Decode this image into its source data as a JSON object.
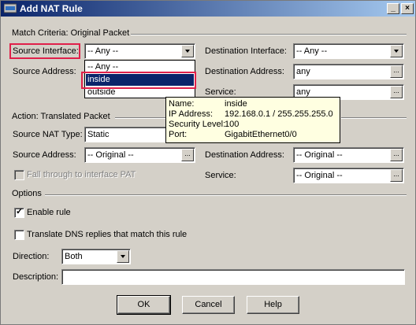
{
  "window": {
    "title": "Add NAT Rule",
    "minimize": "_",
    "close": "×"
  },
  "match": {
    "section_title": "Match Criteria: Original Packet",
    "source_interface_label": "Source Interface:",
    "source_interface_value": "-- Any --",
    "destination_interface_label": "Destination Interface:",
    "destination_interface_value": "-- Any --",
    "source_address_label": "Source Address:",
    "destination_address_label": "Destination Address:",
    "destination_address_value": "any",
    "service_label": "Service:",
    "service_value": "any"
  },
  "dropdown": {
    "options": [
      "-- Any --",
      "inside",
      "outside"
    ],
    "selected_index": 1
  },
  "tooltip": {
    "rows": [
      {
        "label": "Name:",
        "value": "inside"
      },
      {
        "label": "IP Address:",
        "value": "192.168.0.1 / 255.255.255.0"
      },
      {
        "label": "Security Level:",
        "value": "100"
      },
      {
        "label": "Port:",
        "value": "GigabitEthernet0/0"
      }
    ]
  },
  "action": {
    "section_title": "Action: Translated Packet",
    "source_nat_type_label": "Source NAT Type:",
    "source_nat_type_value": "Static",
    "source_address_label": "Source Address:",
    "source_address_value": "-- Original --",
    "destination_address_label": "Destination Address:",
    "destination_address_value": "-- Original --",
    "fall_through_label": "Fall through to interface PAT",
    "service_label": "Service:",
    "service_value": "-- Original --"
  },
  "options": {
    "section_title": "Options",
    "enable_rule_label": "Enable rule",
    "enable_rule_checked": true,
    "translate_dns_label": "Translate DNS replies that match this rule",
    "translate_dns_checked": false,
    "direction_label": "Direction:",
    "direction_value": "Both",
    "description_label": "Description:",
    "description_value": ""
  },
  "buttons": {
    "ok": "OK",
    "cancel": "Cancel",
    "help": "Help"
  },
  "colors": {
    "highlight": "#e0204a",
    "selection": "#0a246a",
    "tooltip_bg": "#ffffe1"
  }
}
